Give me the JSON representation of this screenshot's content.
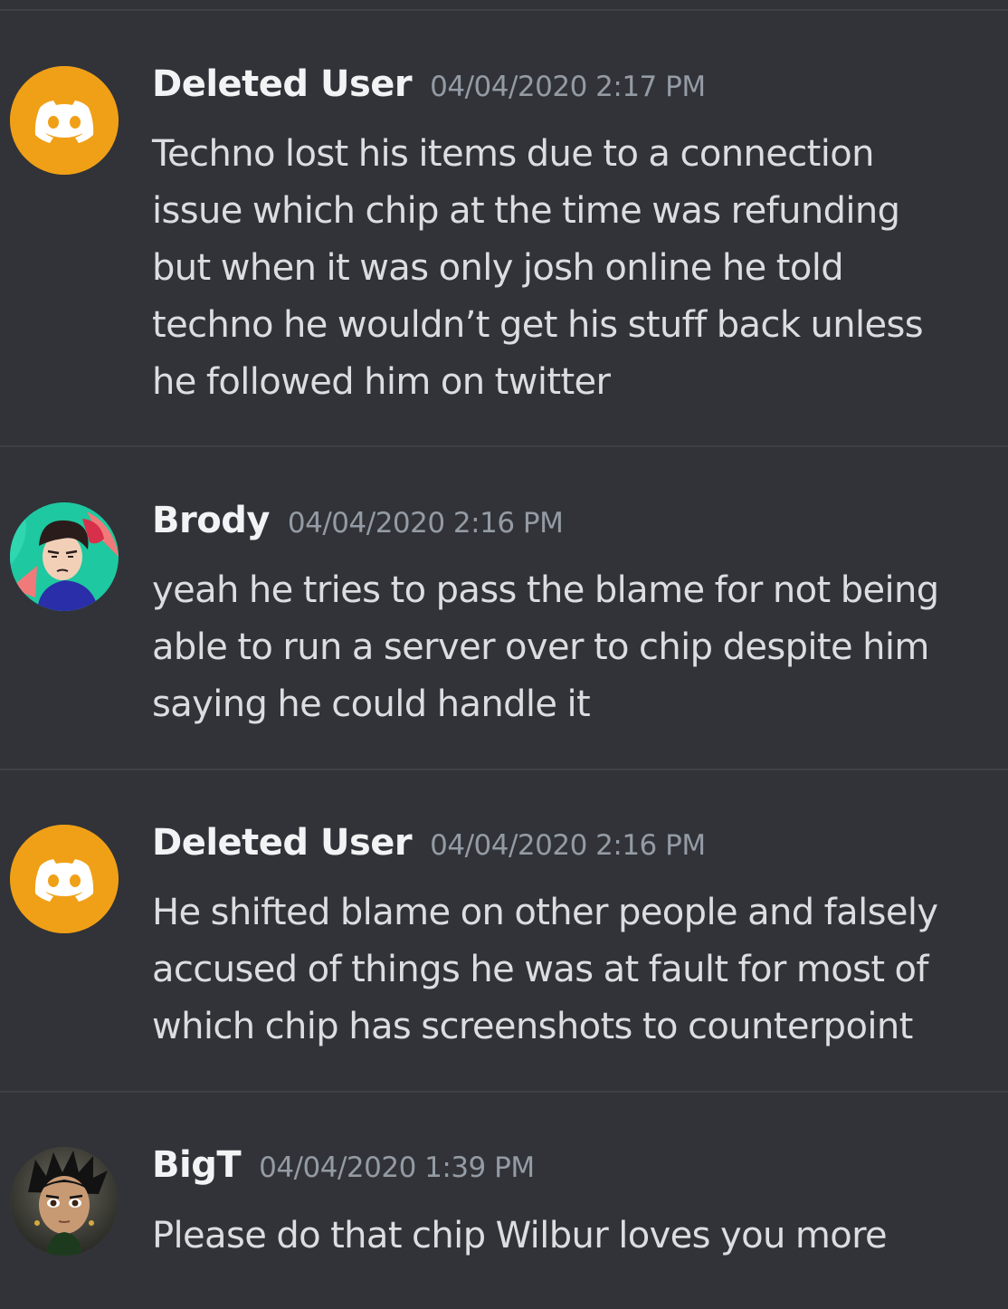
{
  "messages": [
    {
      "avatar_icon": "discord-default-avatar-icon",
      "avatar_color": "#f0a016",
      "username": "Deleted User",
      "timestamp": "04/04/2020 2:17 PM",
      "lines": [
        "Techno lost his items due to a connection",
        "issue which chip at the time was refunding",
        "but when it was only josh online he told",
        "techno he wouldn’t get his stuff back unless",
        "he followed him on twitter"
      ]
    },
    {
      "avatar_icon": "cartoon-avatar-icon",
      "avatar_color": "#1ec8a0",
      "username": "Brody",
      "timestamp": "04/04/2020 2:16 PM",
      "lines": [
        "yeah he tries to pass the blame for not being",
        "able to run a server over to chip despite him",
        "saying he could handle it"
      ]
    },
    {
      "avatar_icon": "discord-default-avatar-icon",
      "avatar_color": "#f0a016",
      "username": "Deleted User",
      "timestamp": "04/04/2020 2:16 PM",
      "lines": [
        "He shifted blame on other people and falsely",
        "accused of things he was at fault for most of",
        "which chip has screenshots to counterpoint"
      ]
    },
    {
      "avatar_icon": "anime-portrait-avatar-icon",
      "avatar_color": "#3a3a34",
      "username": "BigT",
      "timestamp": "04/04/2020 1:39 PM",
      "lines": [
        "Please do that chip Wilbur loves you more"
      ]
    }
  ]
}
